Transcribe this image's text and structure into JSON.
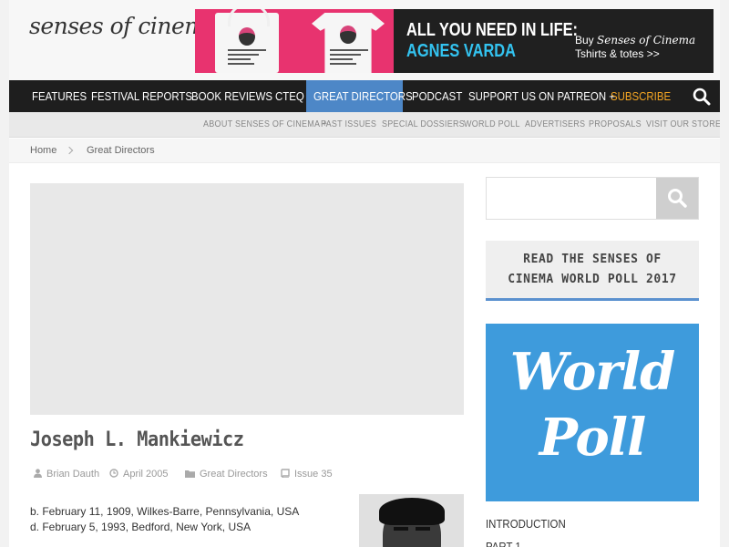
{
  "site": {
    "logo": "senses of cinema"
  },
  "banner": {
    "headline": "ALL YOU NEED IN LIFE:",
    "name": "AGNES VARDA",
    "sub_pre": "Buy ",
    "sub_em": "Senses of Cinema",
    "sub_line2": "Tshirts & totes >>",
    "colors": {
      "pink": "#e8336f",
      "dark": "#202020",
      "cyan": "#33c3f0"
    }
  },
  "mainnav": {
    "items": [
      {
        "label": "Features"
      },
      {
        "label": "Festival Reports"
      },
      {
        "label": "Book Reviews"
      },
      {
        "label": "CTEQ"
      },
      {
        "label": "Great Directors"
      },
      {
        "label": "Podcast"
      },
      {
        "label": "Support us on Patreon +"
      },
      {
        "label": "Subscribe"
      }
    ],
    "active_index": 4,
    "colors": {
      "bar": "#1e1e1e",
      "active": "#4d87c7",
      "accent": "#f5a623"
    }
  },
  "subnav": {
    "items": [
      {
        "label": "About Senses of Cinema +"
      },
      {
        "label": "Past Issues"
      },
      {
        "label": "Special Dossiers"
      },
      {
        "label": "World Poll"
      },
      {
        "label": "Advertisers"
      },
      {
        "label": "Proposals"
      },
      {
        "label": "Visit our store"
      }
    ]
  },
  "breadcrumb": {
    "home": "Home",
    "current": "Great Directors"
  },
  "article": {
    "title": "Joseph L. Mankiewicz",
    "meta": {
      "author": "Brian Dauth",
      "date": "April 2005",
      "category": "Great Directors",
      "issue": "Issue 35"
    },
    "born": "b. February 11, 1909, Wilkes-Barre, Pennsylvania, USA",
    "died": "d. February 5, 1993, Bedford, New York, USA"
  },
  "sidebar": {
    "search_placeholder": "",
    "poll_line1": "Read the Senses of",
    "poll_line2": "Cinema World Poll 2017",
    "poll_image_line1": "World",
    "poll_image_line2": "Poll",
    "intro": "Introduction",
    "part": "Part 1"
  }
}
